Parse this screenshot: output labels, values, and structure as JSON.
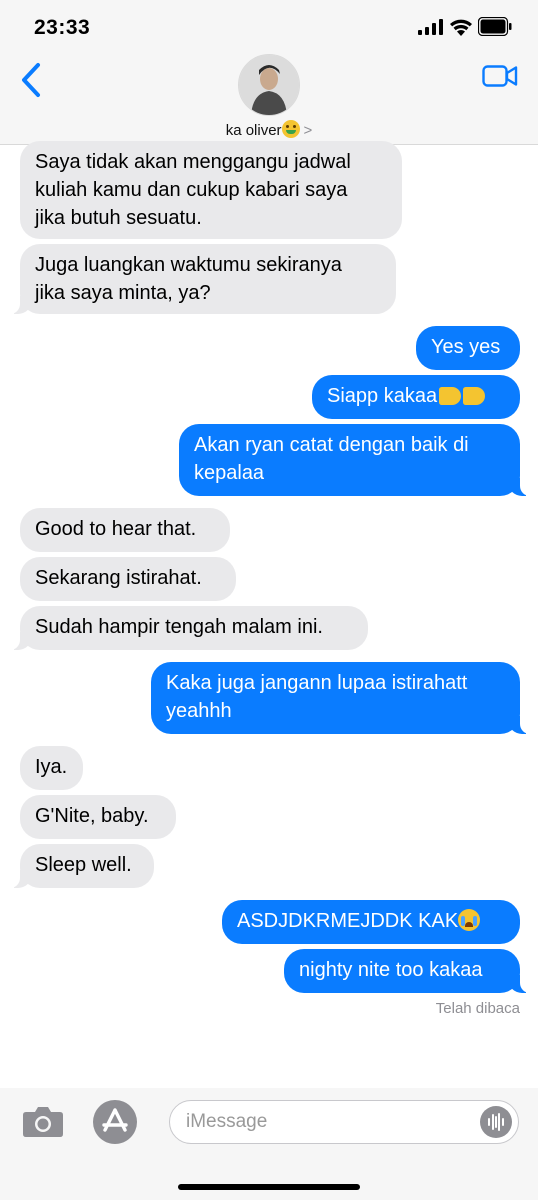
{
  "status": {
    "time": "23:33"
  },
  "header": {
    "contact_name": "ka oliver"
  },
  "messages": [
    {
      "text": "Saya tidak akan menggangu jadwal"
    },
    {
      "text": "kuliah kamu dan cukup kabari saya"
    },
    {
      "text": "jika butuh sesuatu."
    },
    {
      "text": "Juga luangkan waktumu sekiranya"
    },
    {
      "text": "jika saya minta, ya?"
    },
    {
      "text": "Yes yes"
    },
    {
      "text": "Siapp kakaa"
    },
    {
      "text": "Akan ryan catat dengan baik di"
    },
    {
      "text": "kepalaa"
    },
    {
      "text": "Good to hear that."
    },
    {
      "text": "Sekarang istirahat."
    },
    {
      "text": "Sudah hampir tengah malam ini."
    },
    {
      "text": "Kaka juga jangann lupaa istirahatt"
    },
    {
      "text": "yeahhh"
    },
    {
      "text": "Iya."
    },
    {
      "text": "G'Nite, baby."
    },
    {
      "text": "Sleep well."
    },
    {
      "text": "ASDJDKRMEJDDK KAK"
    },
    {
      "text": "nighty nite too kakaa"
    }
  ],
  "read_receipt": "Telah dibaca",
  "composer": {
    "placeholder": "iMessage"
  },
  "colors": {
    "accent": "#0a7cff",
    "incoming": "#e9e9eb"
  }
}
